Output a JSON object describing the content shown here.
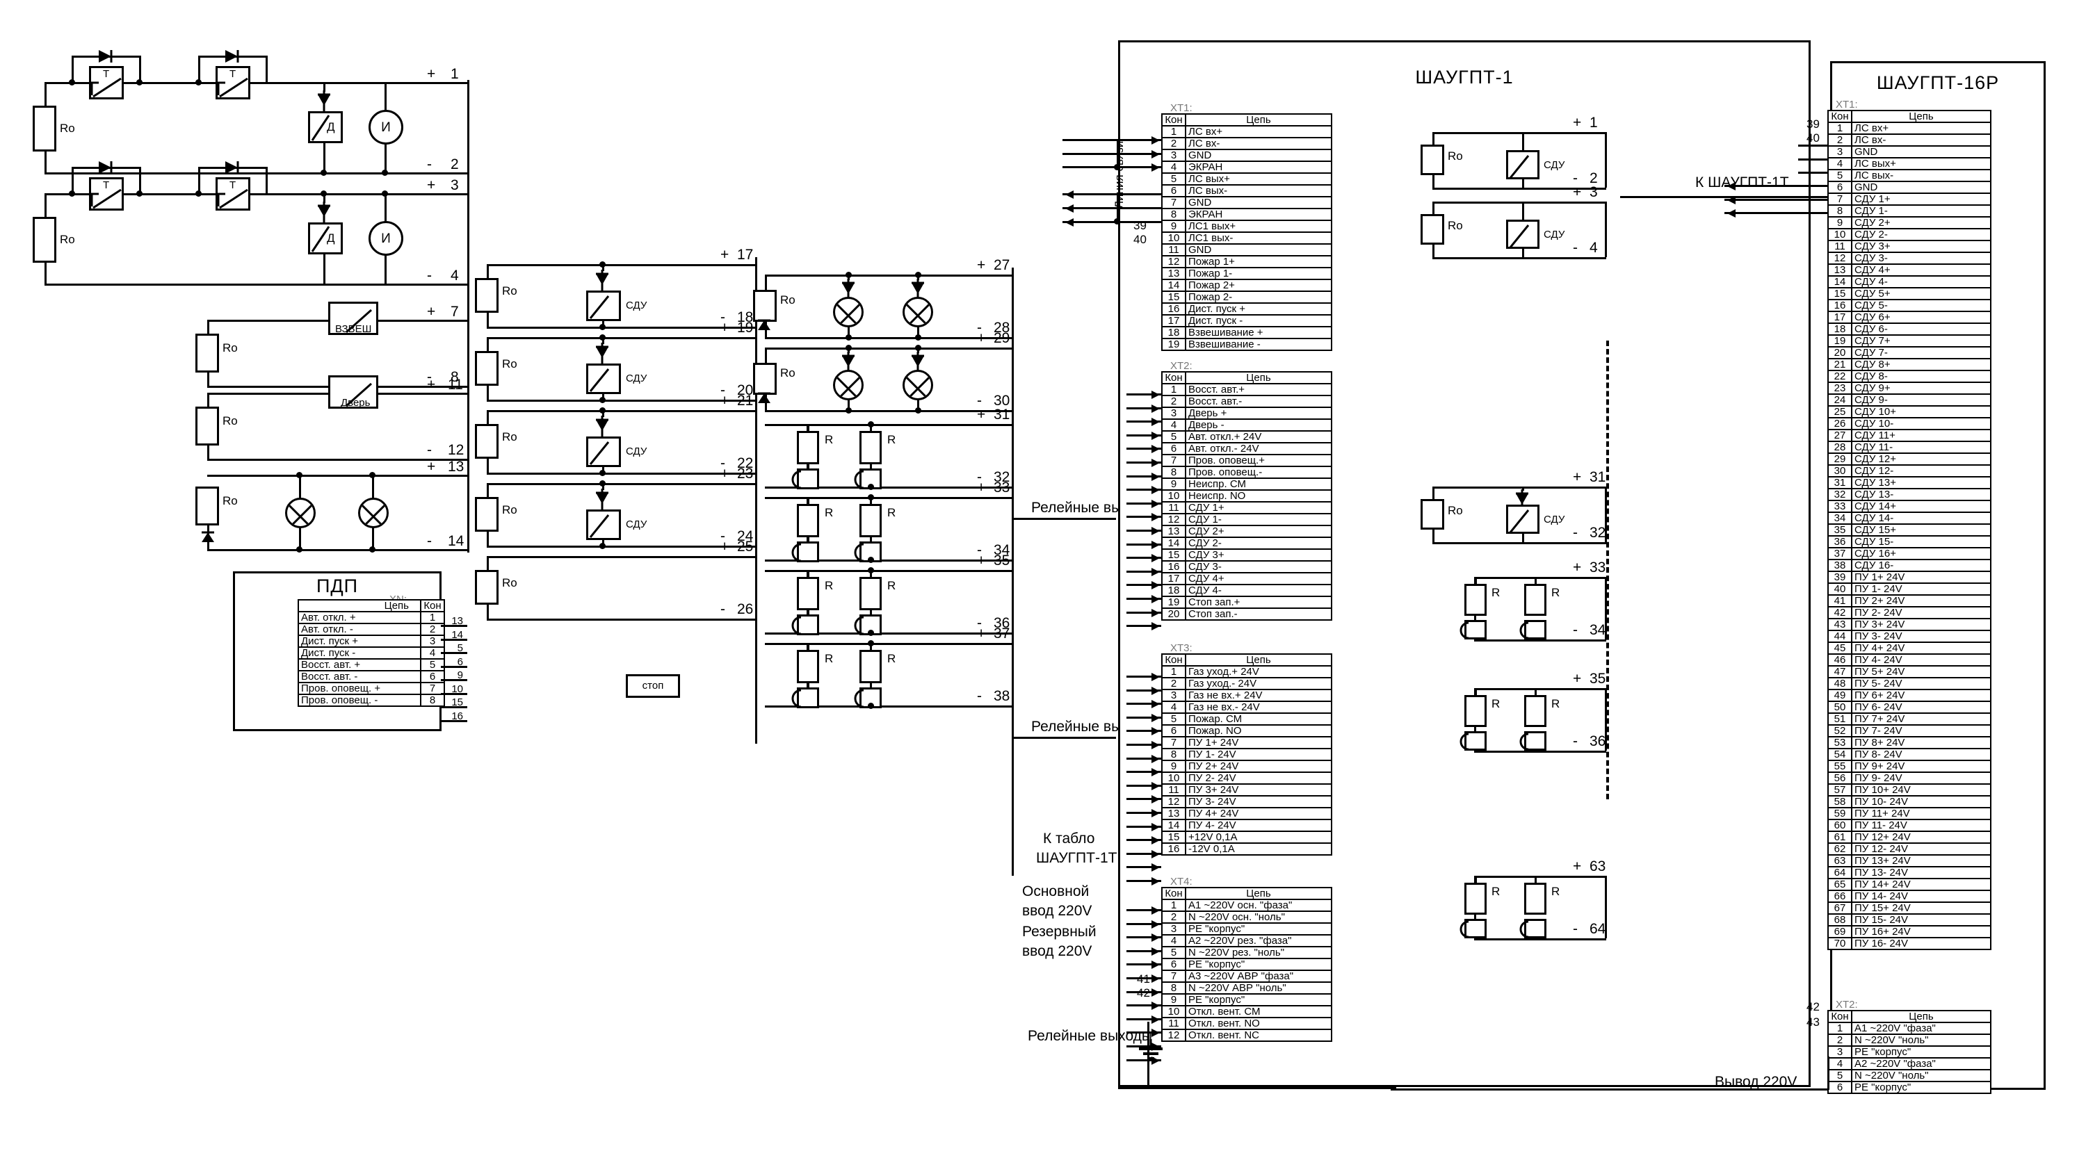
{
  "meta": {
    "diagram_kind": "electrical-schematic",
    "line_color": "#000000",
    "background": "#ffffff"
  },
  "panels": {
    "main": {
      "title": "ШАУГПТ-1"
    },
    "remote": {
      "title": "ШАУГПТ-16Р"
    },
    "pdp": {
      "title": "ПДП",
      "connector": "XN:"
    }
  },
  "table_headers": {
    "pin": "Кон",
    "circuit": "Цепь"
  },
  "connector_labels": {
    "xt1": "XT1:",
    "xt2": "XT2:",
    "xt3": "XT3:",
    "xt4": "XT4:"
  },
  "main_xt1": [
    {
      "pin": "1",
      "circuit": "ЛС вх+"
    },
    {
      "pin": "2",
      "circuit": "ЛС вх-"
    },
    {
      "pin": "3",
      "circuit": "GND"
    },
    {
      "pin": "4",
      "circuit": "ЭКРАН"
    },
    {
      "pin": "5",
      "circuit": "ЛС вых+"
    },
    {
      "pin": "6",
      "circuit": "ЛС вых-"
    },
    {
      "pin": "7",
      "circuit": "GND"
    },
    {
      "pin": "8",
      "circuit": "ЭКРАН"
    },
    {
      "pin": "9",
      "circuit": "ЛС1 вых+"
    },
    {
      "pin": "10",
      "circuit": "ЛС1 вых-"
    },
    {
      "pin": "11",
      "circuit": "GND"
    },
    {
      "pin": "12",
      "circuit": "Пожар 1+"
    },
    {
      "pin": "13",
      "circuit": "Пожар 1-"
    },
    {
      "pin": "14",
      "circuit": "Пожар 2+"
    },
    {
      "pin": "15",
      "circuit": "Пожар 2-"
    },
    {
      "pin": "16",
      "circuit": "Дист. пуск +"
    },
    {
      "pin": "17",
      "circuit": "Дист. пуск -"
    },
    {
      "pin": "18",
      "circuit": "Взвешивание +"
    },
    {
      "pin": "19",
      "circuit": "Взвешивание -"
    }
  ],
  "main_xt2": [
    {
      "pin": "1",
      "circuit": "Восст. авт.+"
    },
    {
      "pin": "2",
      "circuit": "Восст. авт.-"
    },
    {
      "pin": "3",
      "circuit": "Дверь +"
    },
    {
      "pin": "4",
      "circuit": "Дверь -"
    },
    {
      "pin": "5",
      "circuit": "Авт. откл.+ 24V"
    },
    {
      "pin": "6",
      "circuit": "Авт. откл.- 24V"
    },
    {
      "pin": "7",
      "circuit": "Пров. оповещ.+"
    },
    {
      "pin": "8",
      "circuit": "Пров. оповещ.-"
    },
    {
      "pin": "9",
      "circuit": "Неиспр. СМ"
    },
    {
      "pin": "10",
      "circuit": "Неиспр. NO"
    },
    {
      "pin": "11",
      "circuit": "СДУ 1+"
    },
    {
      "pin": "12",
      "circuit": "СДУ 1-"
    },
    {
      "pin": "13",
      "circuit": "СДУ 2+"
    },
    {
      "pin": "14",
      "circuit": "СДУ 2-"
    },
    {
      "pin": "15",
      "circuit": "СДУ 3+"
    },
    {
      "pin": "16",
      "circuit": "СДУ 3-"
    },
    {
      "pin": "17",
      "circuit": "СДУ 4+"
    },
    {
      "pin": "18",
      "circuit": "СДУ 4-"
    },
    {
      "pin": "19",
      "circuit": "Стоп зап.+"
    },
    {
      "pin": "20",
      "circuit": "Стоп зап.-"
    }
  ],
  "main_xt3": [
    {
      "pin": "1",
      "circuit": "Газ уход.+ 24V"
    },
    {
      "pin": "2",
      "circuit": "Газ уход.- 24V"
    },
    {
      "pin": "3",
      "circuit": "Газ не вх.+ 24V"
    },
    {
      "pin": "4",
      "circuit": "Газ не вх.- 24V"
    },
    {
      "pin": "5",
      "circuit": "Пожар. СМ"
    },
    {
      "pin": "6",
      "circuit": "Пожар. NO"
    },
    {
      "pin": "7",
      "circuit": "ПУ 1+ 24V"
    },
    {
      "pin": "8",
      "circuit": "ПУ 1- 24V"
    },
    {
      "pin": "9",
      "circuit": "ПУ 2+ 24V"
    },
    {
      "pin": "10",
      "circuit": "ПУ 2- 24V"
    },
    {
      "pin": "11",
      "circuit": "ПУ 3+ 24V"
    },
    {
      "pin": "12",
      "circuit": "ПУ 3- 24V"
    },
    {
      "pin": "13",
      "circuit": "ПУ 4+ 24V"
    },
    {
      "pin": "14",
      "circuit": "ПУ 4- 24V"
    },
    {
      "pin": "15",
      "circuit": "+12V 0,1A"
    },
    {
      "pin": "16",
      "circuit": "-12V 0,1A"
    }
  ],
  "main_xt4": [
    {
      "pin": "1",
      "circuit": "A1 ~220V осн. \"фаза\""
    },
    {
      "pin": "2",
      "circuit": "N ~220V осн. \"ноль\""
    },
    {
      "pin": "3",
      "circuit": "PE \"корпус\""
    },
    {
      "pin": "4",
      "circuit": "A2 ~220V рез. \"фаза\""
    },
    {
      "pin": "5",
      "circuit": "N ~220V рез. \"ноль\""
    },
    {
      "pin": "6",
      "circuit": "PE \"корпус\""
    },
    {
      "pin": "7",
      "circuit": "A3 ~220V АВР \"фаза\""
    },
    {
      "pin": "8",
      "circuit": "N ~220V АВР \"ноль\""
    },
    {
      "pin": "9",
      "circuit": "PE \"корпус\""
    },
    {
      "pin": "10",
      "circuit": "Откл. вент. СМ"
    },
    {
      "pin": "11",
      "circuit": "Откл. вент. NO"
    },
    {
      "pin": "12",
      "circuit": "Откл. вент. NC"
    }
  ],
  "remote_xt1": [
    {
      "pin": "1",
      "circuit": "ЛС вх+"
    },
    {
      "pin": "2",
      "circuit": "ЛС вх-"
    },
    {
      "pin": "3",
      "circuit": "GND"
    },
    {
      "pin": "4",
      "circuit": "ЛС вых+"
    },
    {
      "pin": "5",
      "circuit": "ЛС вых-"
    },
    {
      "pin": "6",
      "circuit": "GND"
    },
    {
      "pin": "7",
      "circuit": "СДУ 1+"
    },
    {
      "pin": "8",
      "circuit": "СДУ 1-"
    },
    {
      "pin": "9",
      "circuit": "СДУ 2+"
    },
    {
      "pin": "10",
      "circuit": "СДУ 2-"
    },
    {
      "pin": "11",
      "circuit": "СДУ 3+"
    },
    {
      "pin": "12",
      "circuit": "СДУ 3-"
    },
    {
      "pin": "13",
      "circuit": "СДУ 4+"
    },
    {
      "pin": "14",
      "circuit": "СДУ 4-"
    },
    {
      "pin": "15",
      "circuit": "СДУ 5+"
    },
    {
      "pin": "16",
      "circuit": "СДУ 5-"
    },
    {
      "pin": "17",
      "circuit": "СДУ 6+"
    },
    {
      "pin": "18",
      "circuit": "СДУ 6-"
    },
    {
      "pin": "19",
      "circuit": "СДУ 7+"
    },
    {
      "pin": "20",
      "circuit": "СДУ 7-"
    },
    {
      "pin": "21",
      "circuit": "СДУ 8+"
    },
    {
      "pin": "22",
      "circuit": "СДУ 8-"
    },
    {
      "pin": "23",
      "circuit": "СДУ 9+"
    },
    {
      "pin": "24",
      "circuit": "СДУ 9-"
    },
    {
      "pin": "25",
      "circuit": "СДУ 10+"
    },
    {
      "pin": "26",
      "circuit": "СДУ 10-"
    },
    {
      "pin": "27",
      "circuit": "СДУ 11+"
    },
    {
      "pin": "28",
      "circuit": "СДУ 11-"
    },
    {
      "pin": "29",
      "circuit": "СДУ 12+"
    },
    {
      "pin": "30",
      "circuit": "СДУ 12-"
    },
    {
      "pin": "31",
      "circuit": "СДУ 13+"
    },
    {
      "pin": "32",
      "circuit": "СДУ 13-"
    },
    {
      "pin": "33",
      "circuit": "СДУ 14+"
    },
    {
      "pin": "34",
      "circuit": "СДУ 14-"
    },
    {
      "pin": "35",
      "circuit": "СДУ 15+"
    },
    {
      "pin": "36",
      "circuit": "СДУ 15-"
    },
    {
      "pin": "37",
      "circuit": "СДУ 16+"
    },
    {
      "pin": "38",
      "circuit": "СДУ 16-"
    },
    {
      "pin": "39",
      "circuit": "ПУ 1+ 24V"
    },
    {
      "pin": "40",
      "circuit": "ПУ 1- 24V"
    },
    {
      "pin": "41",
      "circuit": "ПУ 2+ 24V"
    },
    {
      "pin": "42",
      "circuit": "ПУ 2- 24V"
    },
    {
      "pin": "43",
      "circuit": "ПУ 3+ 24V"
    },
    {
      "pin": "44",
      "circuit": "ПУ 3- 24V"
    },
    {
      "pin": "45",
      "circuit": "ПУ 4+ 24V"
    },
    {
      "pin": "46",
      "circuit": "ПУ 4- 24V"
    },
    {
      "pin": "47",
      "circuit": "ПУ 5+ 24V"
    },
    {
      "pin": "48",
      "circuit": "ПУ 5- 24V"
    },
    {
      "pin": "49",
      "circuit": "ПУ 6+ 24V"
    },
    {
      "pin": "50",
      "circuit": "ПУ 6- 24V"
    },
    {
      "pin": "51",
      "circuit": "ПУ 7+ 24V"
    },
    {
      "pin": "52",
      "circuit": "ПУ 7- 24V"
    },
    {
      "pin": "53",
      "circuit": "ПУ 8+ 24V"
    },
    {
      "pin": "54",
      "circuit": "ПУ 8- 24V"
    },
    {
      "pin": "55",
      "circuit": "ПУ 9+ 24V"
    },
    {
      "pin": "56",
      "circuit": "ПУ 9- 24V"
    },
    {
      "pin": "57",
      "circuit": "ПУ 10+ 24V"
    },
    {
      "pin": "58",
      "circuit": "ПУ 10- 24V"
    },
    {
      "pin": "59",
      "circuit": "ПУ 11+ 24V"
    },
    {
      "pin": "60",
      "circuit": "ПУ 11- 24V"
    },
    {
      "pin": "61",
      "circuit": "ПУ 12+ 24V"
    },
    {
      "pin": "62",
      "circuit": "ПУ 12- 24V"
    },
    {
      "pin": "63",
      "circuit": "ПУ 13+ 24V"
    },
    {
      "pin": "64",
      "circuit": "ПУ 13- 24V"
    },
    {
      "pin": "65",
      "circuit": "ПУ 14+ 24V"
    },
    {
      "pin": "66",
      "circuit": "ПУ 14- 24V"
    },
    {
      "pin": "67",
      "circuit": "ПУ 15+ 24V"
    },
    {
      "pin": "68",
      "circuit": "ПУ 15- 24V"
    },
    {
      "pin": "69",
      "circuit": "ПУ 16+ 24V"
    },
    {
      "pin": "70",
      "circuit": "ПУ 16- 24V"
    }
  ],
  "remote_xt2": [
    {
      "pin": "1",
      "circuit": "A1 ~220V \"фаза\""
    },
    {
      "pin": "2",
      "circuit": "N ~220V \"ноль\""
    },
    {
      "pin": "3",
      "circuit": "PE \"корпус\""
    },
    {
      "pin": "4",
      "circuit": "A2 ~220V  \"фаза\""
    },
    {
      "pin": "5",
      "circuit": "N ~220V \"ноль\""
    },
    {
      "pin": "6",
      "circuit": "PE \"корпус\""
    }
  ],
  "pdp_rows": [
    {
      "circuit": "Авт. откл. +",
      "pin": "1",
      "link": "13"
    },
    {
      "circuit": "Авт. откл. -",
      "pin": "2",
      "link": "14"
    },
    {
      "circuit": "Дист. пуск +",
      "pin": "3",
      "link": "5"
    },
    {
      "circuit": "Дист. пуск -",
      "pin": "4",
      "link": "6"
    },
    {
      "circuit": "Восст. авт. +",
      "pin": "5",
      "link": "9"
    },
    {
      "circuit": "Восст. авт. -",
      "pin": "6",
      "link": "10"
    },
    {
      "circuit": "Пров. оповещ. +",
      "pin": "7",
      "link": "15"
    },
    {
      "circuit": "Пров. оповещ. -",
      "pin": "8",
      "link": "16"
    }
  ],
  "annotations": {
    "line_link": "Линия связи",
    "relay_outputs_1": "Релейные выходы",
    "relay_outputs_2": "Релейные выходы",
    "relay_outputs_3": "Релейные выходы",
    "to_panel": "К табло",
    "to_panel2": "ШАУГПТ-1Т",
    "main_input": "Основной",
    "main_input2": "ввод 220V",
    "reserve_input": "Резервный",
    "reserve_input2": "ввод 220V",
    "to_shaugpt": "К ШАУГПТ-1Т",
    "output_220": "Вывод 220V"
  },
  "components": {
    "resistor_label": "Ro",
    "r_label": "R",
    "sdu_label": "СДУ",
    "detector_label": "Д",
    "annunciator_label": "И",
    "weigh_label": "ВЗВЕШ",
    "door_label": "Дверь",
    "stop_label": "стоп",
    "thermo_label": "T"
  },
  "left_terminals": [
    {
      "sign": "+",
      "num": "1"
    },
    {
      "sign": "-",
      "num": "2"
    },
    {
      "sign": "+",
      "num": "3"
    },
    {
      "sign": "-",
      "num": "4"
    },
    {
      "sign": "+",
      "num": "7"
    },
    {
      "sign": "-",
      "num": "8"
    },
    {
      "sign": "+",
      "num": "11"
    },
    {
      "sign": "-",
      "num": "12"
    },
    {
      "sign": "+",
      "num": "13"
    },
    {
      "sign": "-",
      "num": "14"
    }
  ],
  "sdu_terminals": [
    {
      "sign": "+",
      "num": "17"
    },
    {
      "sign": "-",
      "num": "18"
    },
    {
      "sign": "+",
      "num": "19"
    },
    {
      "sign": "-",
      "num": "20"
    },
    {
      "sign": "+",
      "num": "21"
    },
    {
      "sign": "-",
      "num": "22"
    },
    {
      "sign": "+",
      "num": "23"
    },
    {
      "sign": "-",
      "num": "24"
    },
    {
      "sign": "+",
      "num": "25"
    },
    {
      "sign": "-",
      "num": "26"
    }
  ],
  "lamp_terminals": [
    {
      "sign": "+",
      "num": "27"
    },
    {
      "sign": "-",
      "num": "28"
    },
    {
      "sign": "+",
      "num": "29"
    },
    {
      "sign": "-",
      "num": "30"
    },
    {
      "sign": "+",
      "num": "31"
    },
    {
      "sign": "-",
      "num": "32"
    },
    {
      "sign": "+",
      "num": "33"
    },
    {
      "sign": "-",
      "num": "34"
    },
    {
      "sign": "+",
      "num": "35"
    },
    {
      "sign": "-",
      "num": "36"
    },
    {
      "sign": "+",
      "num": "37"
    },
    {
      "sign": "-",
      "num": "38"
    }
  ],
  "mid_terminals": [
    {
      "sign": "+",
      "num": "1"
    },
    {
      "sign": "-",
      "num": "2"
    },
    {
      "sign": "+",
      "num": "3"
    },
    {
      "sign": "-",
      "num": "4"
    },
    {
      "sign": "+",
      "num": "31"
    },
    {
      "sign": "-",
      "num": "32"
    },
    {
      "sign": "+",
      "num": "33"
    },
    {
      "sign": "-",
      "num": "34"
    },
    {
      "sign": "+",
      "num": "35"
    },
    {
      "sign": "-",
      "num": "36"
    },
    {
      "sign": "+",
      "num": "63"
    },
    {
      "sign": "-",
      "num": "64"
    }
  ],
  "side_numbers": {
    "n39": "39",
    "n40": "40",
    "n41": "41",
    "n42": "42",
    "n43": "43",
    "left_bus": [
      "1",
      "2",
      "3",
      "4",
      "5",
      "6",
      "7",
      "8",
      "9",
      "10",
      "11",
      "12",
      "13",
      "14",
      "15",
      "16",
      "17",
      "18",
      "19",
      "20",
      "21",
      "22",
      "23",
      "24",
      "25",
      "26",
      "27",
      "28",
      "29",
      "30",
      "31",
      "32",
      "33",
      "34",
      "35",
      "36",
      "37",
      "38"
    ]
  }
}
